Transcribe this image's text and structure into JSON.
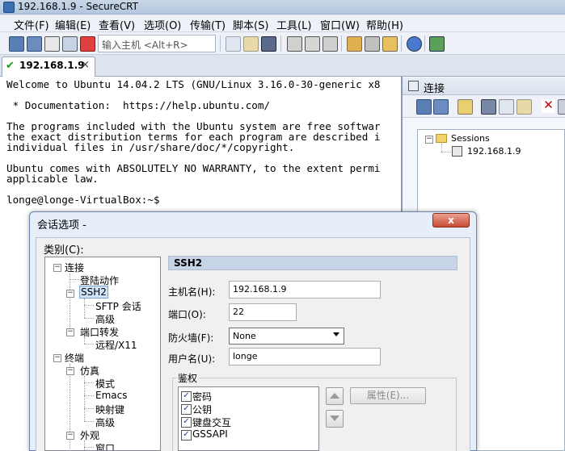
{
  "window": {
    "title": "192.168.1.9 - SecureCRT"
  },
  "menu": [
    "文件(F)",
    "编辑(E)",
    "查看(V)",
    "选项(O)",
    "传输(T)",
    "脚本(S)",
    "工具(L)",
    "窗口(W)",
    "帮助(H)"
  ],
  "toolbar": {
    "quick_connect_placeholder": "输入主机 <Alt+R>"
  },
  "tab": {
    "label": "192.168.1.9",
    "close": "×"
  },
  "terminal": {
    "lines": [
      "Welcome to Ubuntu 14.04.2 LTS (GNU/Linux 3.16.0-30-generic x8",
      "",
      " * Documentation:  https://help.ubuntu.com/",
      "",
      "The programs included with the Ubuntu system are free softwar",
      "the exact distribution terms for each program are described i",
      "individual files in /usr/share/doc/*/copyright.",
      "",
      "Ubuntu comes with ABSOLUTELY NO WARRANTY, to the extent permi",
      "applicable law.",
      "",
      "longe@longe-VirtualBox:~$"
    ]
  },
  "connect_panel": {
    "title": "连接",
    "tree": {
      "root": "Sessions",
      "child": "192.168.1.9"
    }
  },
  "dialog": {
    "title": "会话选项 -",
    "close": "x",
    "category_label": "类别(C):",
    "tree": {
      "connection": "连接",
      "login_actions": "登陆动作",
      "ssh2": "SSH2",
      "sftp": "SFTP 会话",
      "advanced1": "高级",
      "port_forwarding": "端口转发",
      "remote_x11": "远程/X11",
      "terminal": "终端",
      "emulation": "仿真",
      "modes": "模式",
      "emacs": "Emacs",
      "mapped_keys": "映射键",
      "advanced2": "高级",
      "appearance": "外观",
      "window": "窗口"
    },
    "section_header": "SSH2",
    "hostname": {
      "label": "主机名(H):",
      "value": "192.168.1.9"
    },
    "port": {
      "label": "端口(O):",
      "value": "22"
    },
    "firewall": {
      "label": "防火墙(F):",
      "value": "None"
    },
    "username": {
      "label": "用户名(U):",
      "value": "longe"
    },
    "auth": {
      "label": "鉴权",
      "methods": [
        {
          "name": "密码",
          "checked": true
        },
        {
          "name": "公钥",
          "checked": true
        },
        {
          "name": "键盘交互",
          "checked": true
        },
        {
          "name": "GSSAPI",
          "checked": true
        }
      ],
      "properties_button": "属性(E)..."
    }
  }
}
